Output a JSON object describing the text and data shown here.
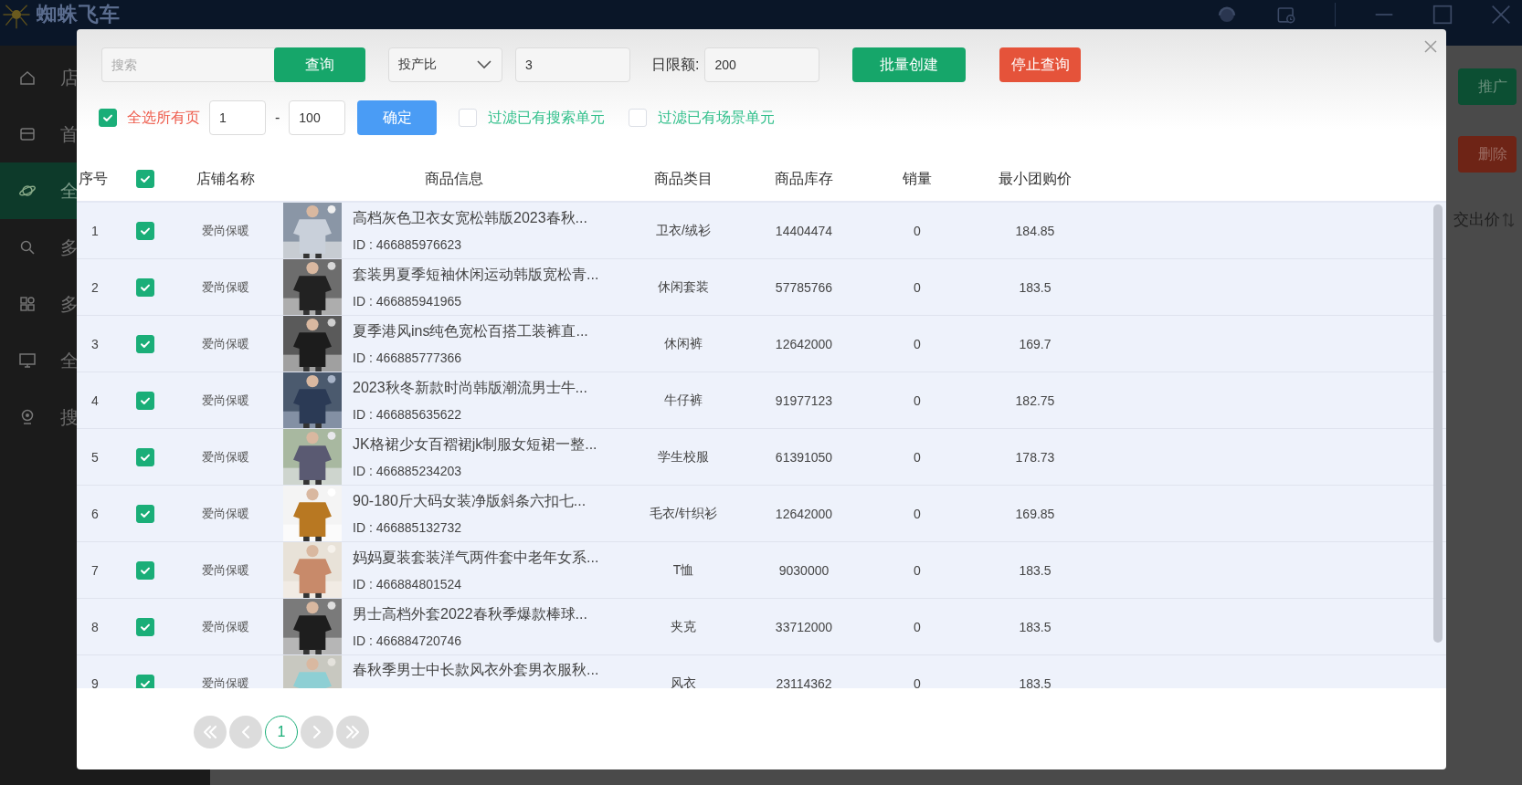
{
  "app": {
    "logo_text": "蜘蛛飞车",
    "sidebar": [
      {
        "label": "店",
        "selected": false
      },
      {
        "label": "首",
        "selected": false
      },
      {
        "label": "全",
        "selected": true
      },
      {
        "label": "多",
        "selected": false
      },
      {
        "label": "多",
        "selected": false
      },
      {
        "label": "全",
        "selected": false
      },
      {
        "label": "搜",
        "selected": false
      }
    ],
    "side_buttons": [
      {
        "label": "推广",
        "kind": "primary"
      },
      {
        "label": "删除",
        "kind": "danger"
      }
    ],
    "side_header": "交出价"
  },
  "dialog": {
    "toolbar": {
      "search_placeholder": "搜索",
      "query_button": "查询",
      "metric_dropdown": "投产比",
      "metric_value": "3",
      "daily_limit_label": "日限额:",
      "daily_limit_value": "200",
      "batch_create_button": "批量创建",
      "stop_button": "停止查询"
    },
    "selection": {
      "select_all": {
        "label": "全选所有页",
        "checked": true
      },
      "range_from": "1",
      "range_separator": "-",
      "range_to": "100",
      "confirm_button": "确定",
      "filters": [
        {
          "label": "过滤已有搜索单元",
          "checked": false
        },
        {
          "label": "过滤已有场景单元",
          "checked": false
        }
      ]
    },
    "table": {
      "header_checked": true,
      "columns": [
        "序号",
        "店铺名称",
        "商品信息",
        "商品类目",
        "商品库存",
        "销量",
        "最小团购价"
      ],
      "rows": [
        {
          "index": "1",
          "checked": true,
          "shop": "爱尚保暖",
          "title": "高档灰色卫衣女宽松韩版2023春秋...",
          "id": "ID : 466885976623",
          "category": "卫衣/绒衫",
          "stock": "14404474",
          "sales": "0",
          "min_price": "184.85"
        },
        {
          "index": "2",
          "checked": true,
          "shop": "爱尚保暖",
          "title": "套装男夏季短袖休闲运动韩版宽松青...",
          "id": "ID : 466885941965",
          "category": "休闲套装",
          "stock": "57785766",
          "sales": "0",
          "min_price": "183.5"
        },
        {
          "index": "3",
          "checked": true,
          "shop": "爱尚保暖",
          "title": "夏季港风ins纯色宽松百搭工装裤直...",
          "id": "ID : 466885777366",
          "category": "休闲裤",
          "stock": "12642000",
          "sales": "0",
          "min_price": "169.7"
        },
        {
          "index": "4",
          "checked": true,
          "shop": "爱尚保暖",
          "title": "2023秋冬新款时尚韩版潮流男士牛...",
          "id": "ID : 466885635622",
          "category": "牛仔裤",
          "stock": "91977123",
          "sales": "0",
          "min_price": "182.75"
        },
        {
          "index": "5",
          "checked": true,
          "shop": "爱尚保暖",
          "title": "JK格裙少女百褶裙jk制服女短裙一整...",
          "id": "ID : 466885234203",
          "category": "学生校服",
          "stock": "61391050",
          "sales": "0",
          "min_price": "178.73"
        },
        {
          "index": "6",
          "checked": true,
          "shop": "爱尚保暖",
          "title": "90-180斤大码女装净版斜条六扣七...",
          "id": "ID : 466885132732",
          "category": "毛衣/针织衫",
          "stock": "12642000",
          "sales": "0",
          "min_price": "169.85"
        },
        {
          "index": "7",
          "checked": true,
          "shop": "爱尚保暖",
          "title": "妈妈夏装套装洋气两件套中老年女系...",
          "id": "ID : 466884801524",
          "category": "T恤",
          "stock": "9030000",
          "sales": "0",
          "min_price": "183.5"
        },
        {
          "index": "8",
          "checked": true,
          "shop": "爱尚保暖",
          "title": "男士高档外套2022春秋季爆款棒球...",
          "id": "ID : 466884720746",
          "category": "夹克",
          "stock": "33712000",
          "sales": "0",
          "min_price": "183.5"
        },
        {
          "index": "9",
          "checked": true,
          "shop": "爱尚保暖",
          "title": "春秋季男士中长款风衣外套男衣服秋...",
          "category": "风衣",
          "stock": "23114362",
          "sales": "0",
          "min_price": "183.5"
        }
      ]
    },
    "pagination": {
      "pages": [
        {
          "label": "1",
          "selected": true
        }
      ]
    }
  }
}
